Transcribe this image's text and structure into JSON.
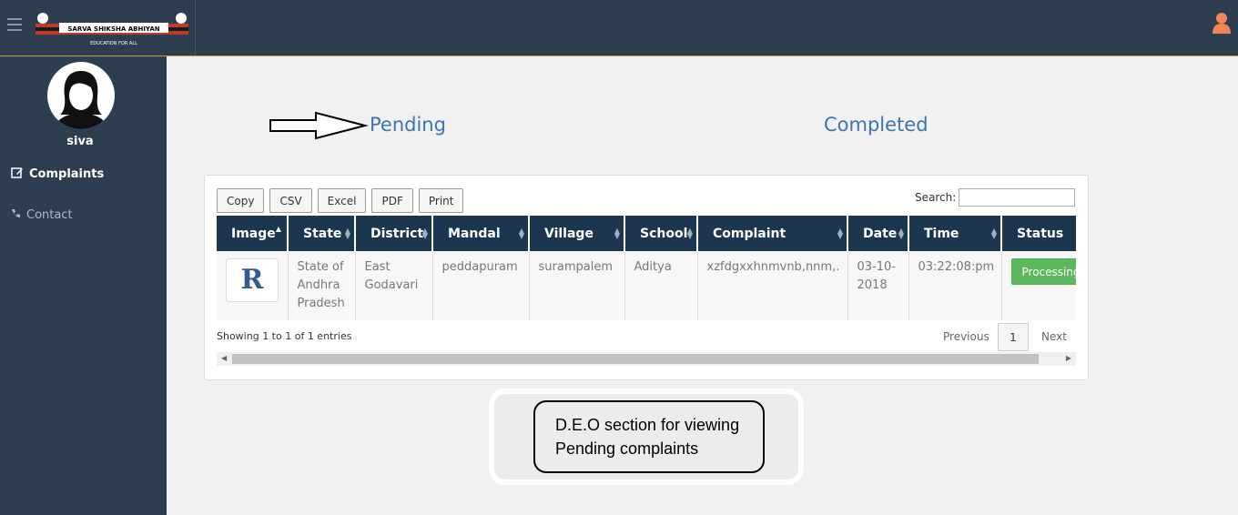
{
  "header": {
    "logo": {
      "text": "SARVA SHIKSHA ABHIYAN",
      "tagline": "EDUCATION FOR ALL"
    },
    "user_icon": "user-icon"
  },
  "sidebar": {
    "username": "siva",
    "items": [
      {
        "label": "Complaints",
        "icon": "edit-icon",
        "active": true
      },
      {
        "label": "Contact",
        "icon": "phone-icon",
        "active": false
      }
    ]
  },
  "tabs": {
    "pending": "Pending",
    "completed": "Completed"
  },
  "table_tools": {
    "buttons": [
      "Copy",
      "CSV",
      "Excel",
      "PDF",
      "Print"
    ],
    "search_label": "Search:"
  },
  "table": {
    "columns": [
      "Image",
      "State",
      "District",
      "Mandal",
      "Village",
      "School",
      "Complaint",
      "Date",
      "Time",
      "Status"
    ],
    "rows": [
      {
        "image": "R",
        "state": "State of Andhra Pradesh",
        "district": "East Godavari",
        "mandal": "peddapuram",
        "village": "surampalem",
        "school": "Aditya",
        "complaint": "xzfdgxxhnmvnb,nnm,.",
        "date": "03-10-2018",
        "time": "03:22:08:pm",
        "status": "Processing"
      }
    ]
  },
  "footer": {
    "info": "Showing 1 to 1 of 1 entries",
    "previous": "Previous",
    "page": "1",
    "next": "Next"
  },
  "annotation": {
    "line1": "D.E.O section for viewing",
    "line2": "Pending complaints"
  },
  "colors": {
    "header_bg": "#2c3e50",
    "table_header": "#1d3650",
    "link": "#3d74b0",
    "status": "#5cb85c"
  }
}
